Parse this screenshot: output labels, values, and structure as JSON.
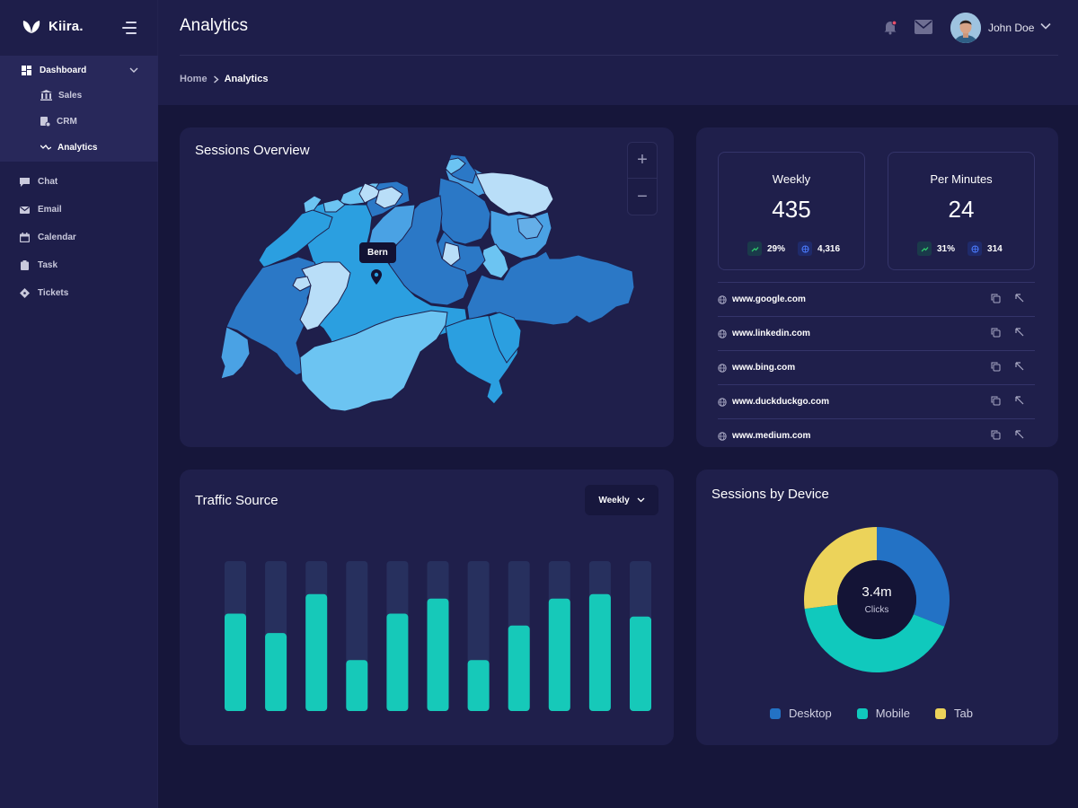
{
  "app": {
    "brand": "Kiira."
  },
  "sidebar": {
    "dashboard": {
      "label": "Dashboard",
      "children": [
        {
          "label": "Sales",
          "icon": "bank-icon"
        },
        {
          "label": "CRM",
          "icon": "crm-icon"
        },
        {
          "label": "Analytics",
          "icon": "analytics-icon"
        }
      ]
    },
    "items": [
      {
        "label": "Chat",
        "icon": "chat-icon"
      },
      {
        "label": "Email",
        "icon": "email-icon"
      },
      {
        "label": "Calendar",
        "icon": "calendar-icon"
      },
      {
        "label": "Task",
        "icon": "clipboard-icon"
      },
      {
        "label": "Tickets",
        "icon": "ticket-icon"
      }
    ]
  },
  "header": {
    "title": "Analytics",
    "breadcrumb": {
      "home": "Home",
      "current": "Analytics"
    },
    "user": {
      "name": "John Doe"
    }
  },
  "sessions_overview": {
    "title": "Sessions Overview",
    "tooltip": "Bern",
    "zoom_in": "+",
    "zoom_out": "−"
  },
  "stats": [
    {
      "label": "Weekly",
      "value": "435",
      "change": "29%",
      "visits": "4,316"
    },
    {
      "label": "Per Minutes",
      "value": "24",
      "change": "31%",
      "visits": "314"
    }
  ],
  "sites": [
    {
      "url": "www.google.com"
    },
    {
      "url": "www.linkedin.com"
    },
    {
      "url": "www.bing.com"
    },
    {
      "url": "www.duckduckgo.com"
    },
    {
      "url": "www.medium.com"
    }
  ],
  "traffic_source": {
    "title": "Traffic Source",
    "period": "Weekly"
  },
  "chart_data": {
    "type": "bar",
    "title": "Traffic Source",
    "values": [
      65,
      52,
      78,
      34,
      65,
      75,
      34,
      57,
      75,
      78,
      63
    ],
    "max": 100,
    "colors": {
      "bar": "#16c9b9",
      "track": "#27305e"
    }
  },
  "sessions_by_device": {
    "title": "Sessions by Device",
    "center_value": "3.4m",
    "center_label": "Clicks",
    "legend": [
      {
        "name": "Desktop",
        "color": "#2372c5",
        "share": 0.31
      },
      {
        "name": "Mobile",
        "color": "#10c9bd",
        "share": 0.42
      },
      {
        "name": "Tab",
        "color": "#ecd35a",
        "share": 0.27
      }
    ]
  }
}
